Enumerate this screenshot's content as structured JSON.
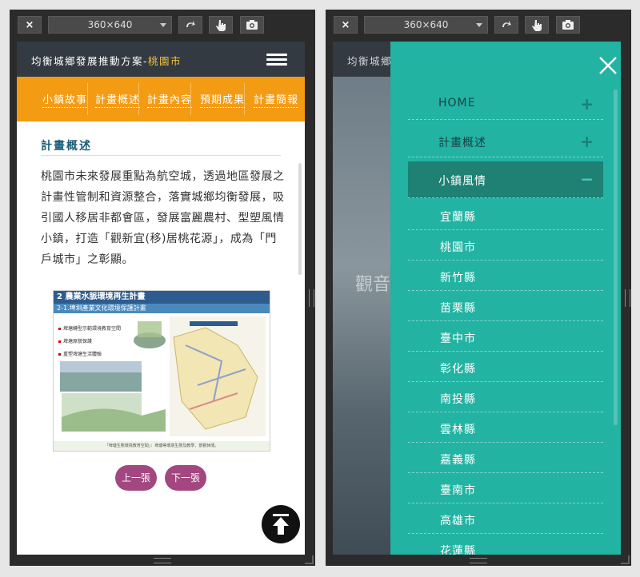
{
  "toolbar": {
    "close_label": "×",
    "device_size": "360×640"
  },
  "left": {
    "header": {
      "title_prefix": "均衡城鄉發展推動方案-",
      "title_city": "桃園市"
    },
    "tabs": [
      "小鎮故事",
      "計畫概述",
      "計畫內容",
      "預期成果",
      "計畫簡報"
    ],
    "section_title": "計畫概述",
    "body": "桃園市未來發展重點為航空城，透過地區發展之計畫性管制和資源整合，落實城鄉均衡發展，吸引國人移居非都會區，發展富麗農村、型塑風情小鎮，打造「觀新宜(移)居桃花源」，成為「門戶城市」之彰顯。",
    "slide": {
      "heading": "2 農業水脈環境再生計畫",
      "subheading": "2-1.埤圳產業文化環境保護計畫",
      "bullets": [
        "埤塘轉型示範環境教育空間",
        "埤塘原貌保護",
        "重塑埤塘生活體驗"
      ],
      "footer": "「埤塘生態環境教育空間」：埤塘等環境生態及教學、景觀休閒。"
    },
    "prev_label": "上一張",
    "next_label": "下一張"
  },
  "right": {
    "bg_title": "均衡城鄉",
    "bg_text": "觀音",
    "menu": [
      {
        "label": "HOME",
        "icon": "+"
      },
      {
        "label": "計畫概述",
        "icon": "+"
      },
      {
        "label": "小鎮風情",
        "icon": "−"
      }
    ],
    "submenu": [
      "宜蘭縣",
      "桃園市",
      "新竹縣",
      "苗栗縣",
      "臺中市",
      "彰化縣",
      "南投縣",
      "雲林縣",
      "嘉義縣",
      "臺南市",
      "高雄市",
      "花蓮縣"
    ]
  },
  "colors": {
    "header": "#333a42",
    "accent_orange": "#f49b14",
    "city_yellow": "#f7c33b",
    "teal": "#22b3a2",
    "active_teal": "#1e8173",
    "button_purple": "#a2477f"
  }
}
